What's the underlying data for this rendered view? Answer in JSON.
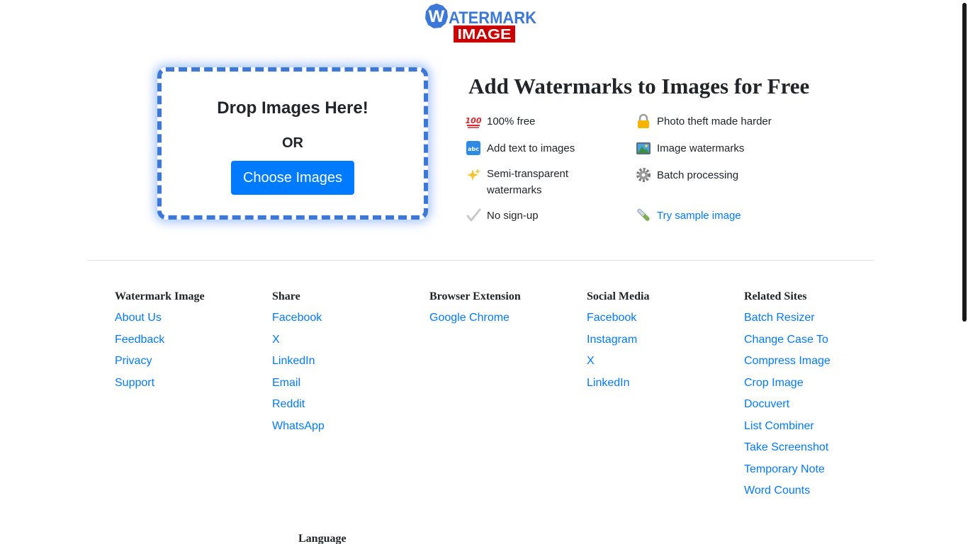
{
  "logo": {
    "line1_w": "W",
    "line1_rest": "ATERMARK",
    "line2": "IMAGE",
    "blue": "#3b78d8",
    "red": "#cc0000"
  },
  "dropzone": {
    "title": "Drop Images Here!",
    "or": "OR",
    "button": "Choose Images"
  },
  "hero": {
    "title": "Add Watermarks to Images for Free",
    "features": [
      {
        "icon": "hundred-icon",
        "text": "100% free"
      },
      {
        "icon": "lock-icon",
        "text": "Photo theft made harder"
      },
      {
        "icon": "abc-icon",
        "text": "Add text to images"
      },
      {
        "icon": "picture-icon",
        "text": "Image watermarks"
      },
      {
        "icon": "sparkles-icon",
        "text": "Semi-transparent watermarks"
      },
      {
        "icon": "gear-icon",
        "text": "Batch processing"
      },
      {
        "icon": "check-icon",
        "text": "No sign-up"
      },
      {
        "icon": "test-tube-icon",
        "text": "Try sample image"
      }
    ]
  },
  "footer": {
    "watermark_image": {
      "title": "Watermark Image",
      "links": [
        "About Us",
        "Feedback",
        "Privacy",
        "Support"
      ]
    },
    "share": {
      "title": "Share",
      "links": [
        "Facebook",
        "X",
        "LinkedIn",
        "Email",
        "Reddit",
        "WhatsApp"
      ]
    },
    "browser_extension": {
      "title": "Browser Extension",
      "links": [
        "Google Chrome"
      ]
    },
    "social_media": {
      "title": "Social Media",
      "links": [
        "Facebook",
        "Instagram",
        "X",
        "LinkedIn"
      ]
    },
    "related_sites": {
      "title": "Related Sites",
      "links": [
        "Batch Resizer",
        "Change Case To",
        "Compress Image",
        "Crop Image",
        "Docuvert",
        "List Combiner",
        "Take Screenshot",
        "Temporary Note",
        "Word Counts"
      ]
    },
    "language": {
      "title": "Language"
    }
  },
  "colors": {
    "accent": "#007bff",
    "dropzone_border": "#3b78d8"
  }
}
